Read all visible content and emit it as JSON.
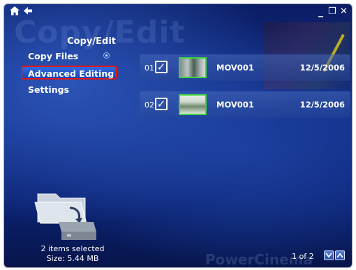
{
  "window": {
    "home_icon": "home-icon",
    "back_icon": "back-arrow-icon",
    "minimize_glyph": "_",
    "restore_glyph": "❐",
    "close_glyph": "✕"
  },
  "watermark_title": "Copy/Edit",
  "section_title": "Copy/Edit",
  "menu": {
    "copy_files": "Copy Files",
    "advanced_editing": "Advanced Editing",
    "settings": "Settings"
  },
  "files": [
    {
      "number": "01",
      "checked": "✓",
      "name": "MOV001",
      "date": "12/5/2006"
    },
    {
      "number": "02",
      "checked": "✓",
      "name": "MOV001",
      "date": "12/5/2006"
    }
  ],
  "status": {
    "selected": "2 items selected",
    "size": "Size: 5.44 MB"
  },
  "footer_brand": "PowerCinema",
  "pager": {
    "text": "1 of 2"
  },
  "colors": {
    "highlight_border": "#e01818",
    "thumb_border": "#3fd33f",
    "background": "#102d88"
  }
}
